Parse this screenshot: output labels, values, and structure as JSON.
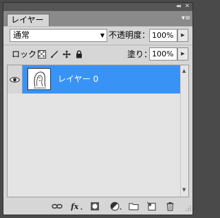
{
  "panel": {
    "tab_label": "レイヤー",
    "controls": {
      "collapse_icon": "double-chevron-left-icon",
      "close_icon": "close-icon",
      "menu_icon": "panel-menu-icon"
    }
  },
  "blend_mode": {
    "value": "通常"
  },
  "opacity": {
    "label": "不透明度：",
    "value": "100%"
  },
  "lock": {
    "label": "ロック：",
    "icons": [
      "lock-transparent-pixels-icon",
      "lock-image-pixels-icon",
      "lock-position-icon",
      "lock-all-icon"
    ]
  },
  "fill": {
    "label": "塗り：",
    "value": "100%"
  },
  "layers": [
    {
      "name": "レイヤー 0",
      "visible": true,
      "selected": true
    }
  ],
  "colors": {
    "selection": "#3993f7",
    "panel_bg": "#d6d6d6",
    "tab_bar": "#8a8a8a"
  },
  "bottom_toolbar": {
    "icons": [
      "link-layers-icon",
      "fx-icon",
      "add-mask-icon",
      "adjustment-layer-icon",
      "new-group-icon",
      "new-layer-icon",
      "trash-icon"
    ]
  }
}
